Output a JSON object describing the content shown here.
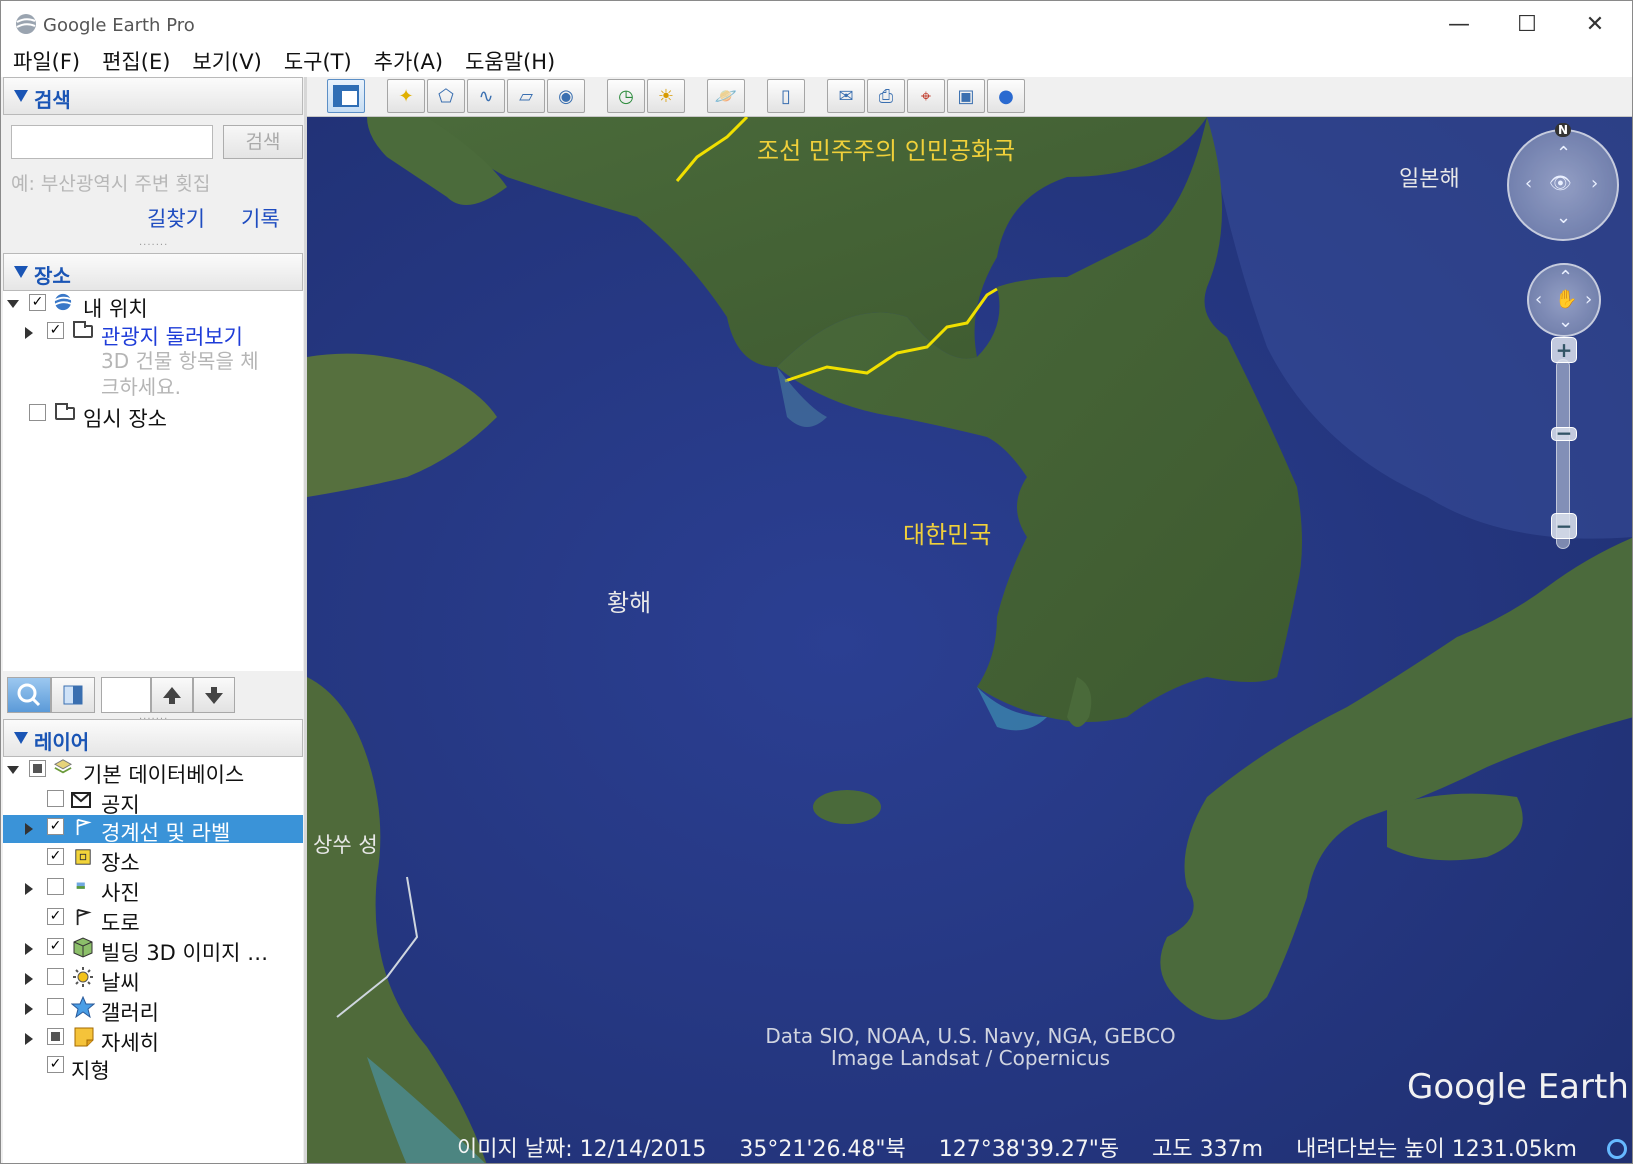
{
  "window": {
    "title": "Google Earth Pro",
    "min_glyph": "—",
    "max_glyph": "☐",
    "close_glyph": "✕"
  },
  "menu": [
    "파일(F)",
    "편집(E)",
    "보기(V)",
    "도구(T)",
    "추가(A)",
    "도움말(H)"
  ],
  "search": {
    "header": "검색",
    "input_value": "",
    "button_label": "검색",
    "hint": "예: 부산광역시 주변 횟집",
    "directions_label": "길찾기",
    "history_label": "기록"
  },
  "places": {
    "header": "장소",
    "items": [
      {
        "label": "내 위치",
        "checked": true,
        "expanded": true
      },
      {
        "label": "관광지 둘러보기",
        "checked": true,
        "expanded": false,
        "subtext_line1": "3D 건물 항목을 체",
        "subtext_line2": "크하세요."
      },
      {
        "label": "임시 장소",
        "checked": false
      }
    ]
  },
  "layers": {
    "header": "레이어",
    "root": {
      "label": "기본 데이터베이스",
      "checked": "partial",
      "expanded": true
    },
    "items": [
      {
        "label": "공지",
        "checked": false,
        "icon": "envelope-icon"
      },
      {
        "label": "경계선 및 라벨",
        "checked": true,
        "icon": "flag-icon",
        "selected": true
      },
      {
        "label": "장소",
        "checked": true,
        "icon": "square-icon"
      },
      {
        "label": "사진",
        "checked": false,
        "icon": "photo-icon"
      },
      {
        "label": "도로",
        "checked": true,
        "icon": "flag-icon"
      },
      {
        "label": "빌딩 3D 이미지 …",
        "checked": true,
        "icon": "cube-icon"
      },
      {
        "label": "날씨",
        "checked": false,
        "icon": "sun-icon"
      },
      {
        "label": "갤러리",
        "checked": false,
        "icon": "star-icon"
      },
      {
        "label": "자세히",
        "checked": "partial",
        "icon": "note-icon"
      },
      {
        "label": "지형",
        "checked": true,
        "icon": ""
      }
    ]
  },
  "map": {
    "labels": {
      "north_korea": "조선 민주주의 인민공화국",
      "south_korea": "대한민국",
      "yellow_sea": "황해",
      "sea_of_japan": "일본해",
      "province": "상쑤 성"
    },
    "compass_north": "N",
    "attribution_line1": "Data SIO, NOAA, U.S. Navy, NGA, GEBCO",
    "attribution_line2": "Image Landsat / Copernicus",
    "logo": "Google Earth",
    "status": {
      "image_date": "이미지 날짜: 12/14/2015",
      "latitude": "35°21'26.48\"북",
      "longitude": "127°38'39.27\"동",
      "elevation": "고도   337m",
      "eye_altitude": "내려다보는 높이 1231.05km"
    }
  },
  "colors": {
    "selection": "#3a93d8",
    "link": "#1e4cc0",
    "border_line": "#f0e000",
    "ocean": "#2a3d85"
  }
}
